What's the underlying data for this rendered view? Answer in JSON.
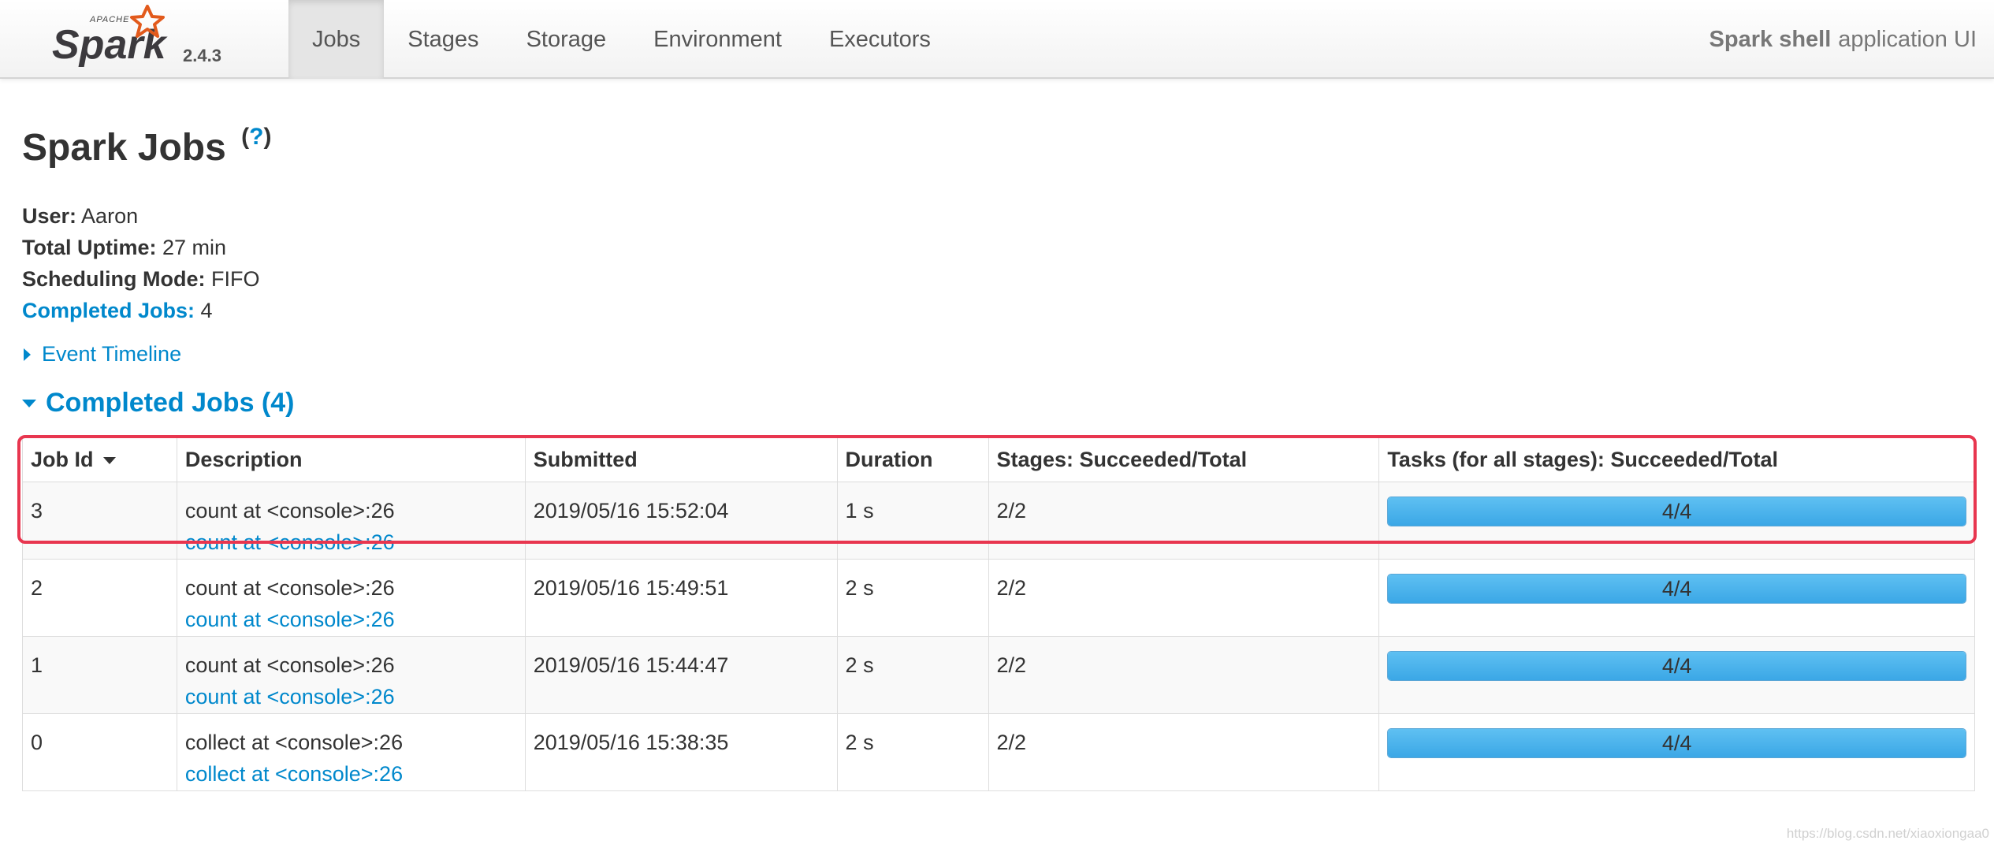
{
  "navbar": {
    "brand": {
      "top_word": "APACHE",
      "name": "Spark",
      "version": "2.4.3"
    },
    "tabs": [
      {
        "label": "Jobs",
        "active": true
      },
      {
        "label": "Stages",
        "active": false
      },
      {
        "label": "Storage",
        "active": false
      },
      {
        "label": "Environment",
        "active": false
      },
      {
        "label": "Executors",
        "active": false
      }
    ],
    "app_title_strong": "Spark shell",
    "app_title_rest": "application UI"
  },
  "page": {
    "title": "Spark Jobs",
    "help_open": "(",
    "help_q": "?",
    "help_close": ")"
  },
  "summary": {
    "user_label": "User:",
    "user_value": "Aaron",
    "uptime_label": "Total Uptime:",
    "uptime_value": "27 min",
    "mode_label": "Scheduling Mode:",
    "mode_value": "FIFO",
    "completed_label": "Completed Jobs:",
    "completed_value": "4"
  },
  "timeline": {
    "label": "Event Timeline"
  },
  "completed_section": {
    "heading": "Completed Jobs (4)"
  },
  "table": {
    "headers": [
      "Job Id",
      "Description",
      "Submitted",
      "Duration",
      "Stages: Succeeded/Total",
      "Tasks (for all stages): Succeeded/Total"
    ],
    "rows": [
      {
        "job_id": "3",
        "desc": "count at <console>:26",
        "desc_link": "count at <console>:26",
        "submitted": "2019/05/16 15:52:04",
        "duration": "1 s",
        "stages": "2/2",
        "tasks": "4/4",
        "tasks_fraction": 1.0
      },
      {
        "job_id": "2",
        "desc": "count at <console>:26",
        "desc_link": "count at <console>:26",
        "submitted": "2019/05/16 15:49:51",
        "duration": "2 s",
        "stages": "2/2",
        "tasks": "4/4",
        "tasks_fraction": 1.0
      },
      {
        "job_id": "1",
        "desc": "count at <console>:26",
        "desc_link": "count at <console>:26",
        "submitted": "2019/05/16 15:44:47",
        "duration": "2 s",
        "stages": "2/2",
        "tasks": "4/4",
        "tasks_fraction": 1.0
      },
      {
        "job_id": "0",
        "desc": "collect at <console>:26",
        "desc_link": "collect at <console>:26",
        "submitted": "2019/05/16 15:38:35",
        "duration": "2 s",
        "stages": "2/2",
        "tasks": "4/4",
        "tasks_fraction": 1.0
      }
    ]
  },
  "watermark": "https://blog.csdn.net/xiaoxiongaa0",
  "colors": {
    "link": "#0088cc",
    "progress": "#3ba7e6",
    "highlight": "#e8364f",
    "spark_orange": "#e25a1c"
  },
  "icons": {
    "sort": "caret-down-icon",
    "timeline_toggle": "caret-right-icon",
    "section_toggle": "caret-down-icon",
    "brand_star": "spark-star-icon"
  }
}
